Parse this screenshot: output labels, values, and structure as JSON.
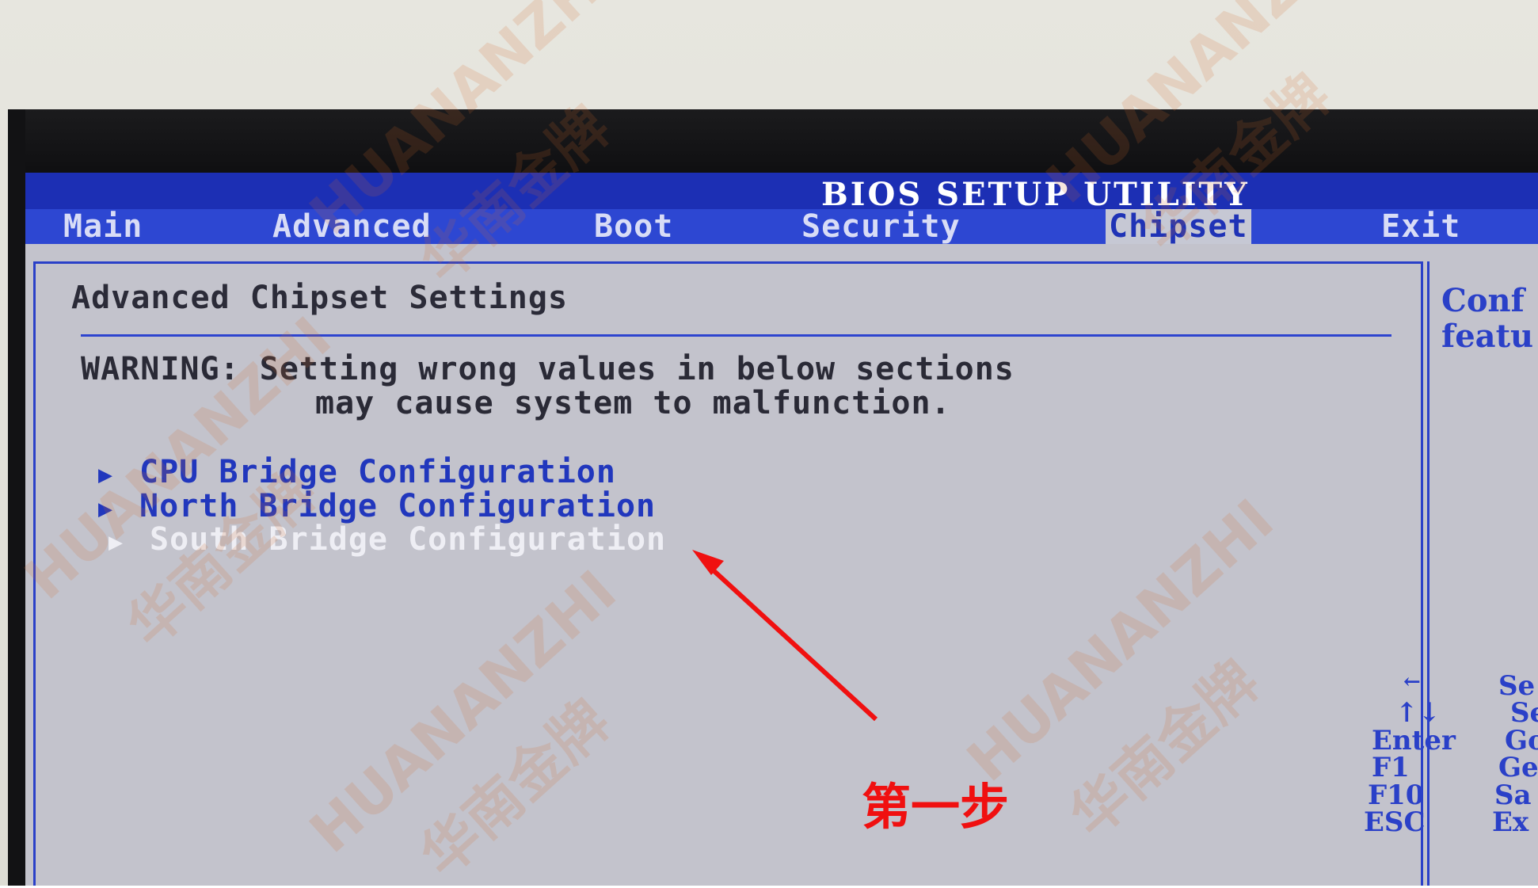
{
  "bios": {
    "title": "BIOS SETUP UTILITY",
    "tabs": [
      {
        "label": "Main"
      },
      {
        "label": "Advanced"
      },
      {
        "label": "Boot"
      },
      {
        "label": "Security"
      },
      {
        "label": "Chipset",
        "active": true
      },
      {
        "label": "Exit"
      }
    ],
    "section_title": "Advanced Chipset Settings",
    "warning_line1": "WARNING: Setting wrong values in below sections",
    "warning_line2": "may cause system to malfunction.",
    "items": [
      {
        "label": "CPU Bridge Configuration",
        "arrow": "▶"
      },
      {
        "label": "North Bridge Configuration",
        "arrow": "▶"
      },
      {
        "label": "South Bridge Configuration",
        "arrow": "▶",
        "selected": true
      }
    ],
    "help": {
      "line1": "Conf",
      "line2": "featu"
    },
    "keys": [
      {
        "key": "←",
        "desc": "Se"
      },
      {
        "key": "↑↓",
        "desc": "Se"
      },
      {
        "key": "Enter",
        "desc": "Go"
      },
      {
        "key": "F1",
        "desc": "Ge"
      },
      {
        "key": "F10",
        "desc": "Sa"
      },
      {
        "key": "ESC",
        "desc": "Ex"
      }
    ]
  },
  "annotation": {
    "label": "第一步",
    "color": "#f01010"
  },
  "watermark": {
    "text_latin": "HUANANZHI",
    "text_cn": "华南金牌"
  },
  "colors": {
    "title_bar": "#1c2fb4",
    "menu_bar": "#2d47d2",
    "screen_bg": "#c3c3cc",
    "accent_blue": "#2137bd"
  }
}
